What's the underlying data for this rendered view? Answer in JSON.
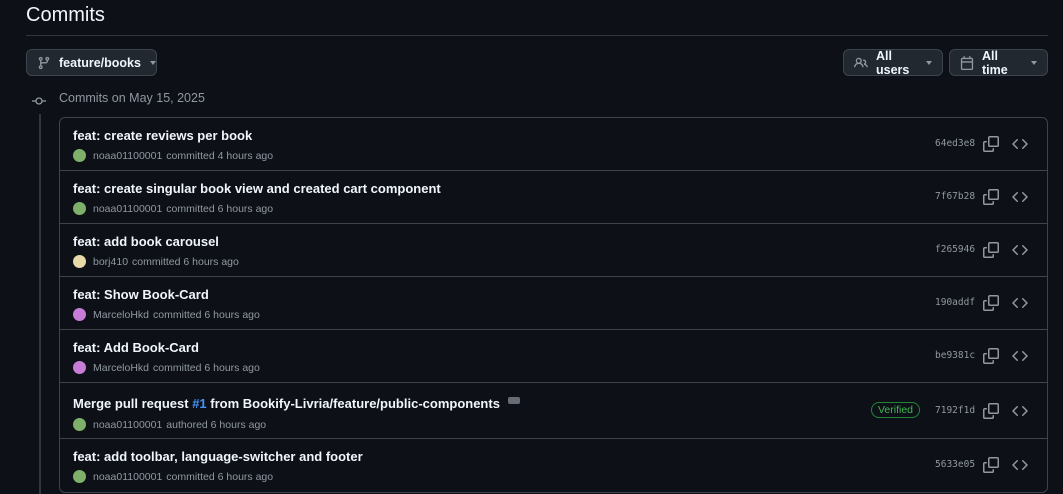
{
  "page": {
    "title": "Commits"
  },
  "filters": {
    "branch_label": "feature/books",
    "users_label": "All users",
    "time_label": "All time"
  },
  "group": {
    "header": "Commits on May 15, 2025"
  },
  "commits": [
    {
      "title": "feat: create reviews per book",
      "author": "noaa01100001",
      "action": "committed",
      "time": "4 hours ago",
      "sha": "64ed3e8",
      "avatar_color": "#7fb069"
    },
    {
      "title": "feat: create singular book view and created cart component",
      "author": "noaa01100001",
      "action": "committed",
      "time": "6 hours ago",
      "sha": "7f67b28",
      "avatar_color": "#7fb069"
    },
    {
      "title": "feat: add book carousel",
      "author": "borj410",
      "action": "committed",
      "time": "6 hours ago",
      "sha": "f265946",
      "avatar_color": "#e8d9a8"
    },
    {
      "title": "feat: Show Book-Card",
      "author": "MarceloHkd",
      "action": "committed",
      "time": "6 hours ago",
      "sha": "190addf",
      "avatar_color": "#c77dd6"
    },
    {
      "title": "feat: Add Book-Card",
      "author": "MarceloHkd",
      "action": "committed",
      "time": "6 hours ago",
      "sha": "be9381c",
      "avatar_color": "#c77dd6"
    },
    {
      "title_prefix": "Merge pull request ",
      "pr_number": "#1",
      "title_suffix": " from Bookify-Livria/feature/public-components",
      "author": "noaa01100001",
      "action": "authored",
      "time": "6 hours ago",
      "sha": "7192f1d",
      "verified": "Verified",
      "avatar_color": "#7fb069"
    },
    {
      "title": "feat: add toolbar, language-switcher and footer",
      "author": "noaa01100001",
      "action": "committed",
      "time": "6 hours ago",
      "sha": "5633e05",
      "avatar_color": "#7fb069"
    }
  ]
}
